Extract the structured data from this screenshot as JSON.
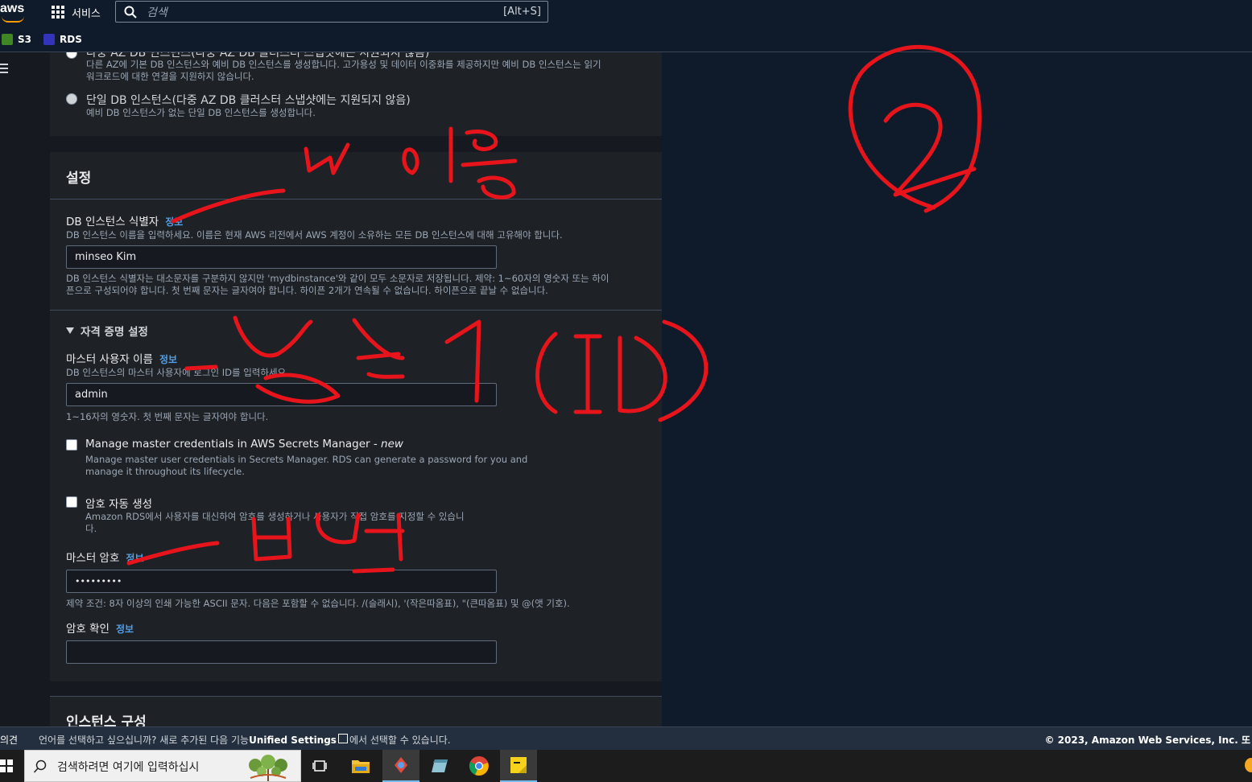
{
  "topnav": {
    "logo": "aws",
    "services_label": "서비스",
    "search_placeholder": "검색",
    "search_shortcut": "[Alt+S]"
  },
  "favorites": [
    {
      "label": "S3",
      "icon": "s3-icon",
      "color": "#3f8624"
    },
    {
      "label": "RDS",
      "icon": "rds-icon",
      "color": "#3334b9"
    }
  ],
  "availability": {
    "multi_az_title": "다중 AZ DB 인스턴스(다중 AZ DB 클러스터 스냅샷에는 지원되지 않음)",
    "multi_az_desc_1": "다른 AZ에 기본 DB 인스턴스와 예비 DB 인스턴스를 생성합니다. 고가용성 및 데이터 이중화를 제공하지만 예비 DB 인스턴스는 읽기",
    "multi_az_desc_2": "워크로드에 대한 연결을 지원하지 않습니다.",
    "single_title": "단일 DB 인스턴스(다중 AZ DB 클러스터 스냅샷에는 지원되지 않음)",
    "single_desc": "예비 DB 인스턴스가 없는 단일 DB 인스턴스를 생성합니다."
  },
  "settings": {
    "title": "설정",
    "db_identifier": {
      "label": "DB 인스턴스 식별자",
      "info": "정보",
      "desc": "DB 인스턴스 이름을 입력하세요. 이름은 현재 AWS 리전에서 AWS 계정이 소유하는 모든 DB 인스턴스에 대해 고유해야 합니다.",
      "value": "minseo Kim",
      "constraint_1": "DB 인스턴스 식별자는 대소문자를 구분하지 않지만 'mydbinstance'와 같이 모두 소문자로 저장됩니다. 제약: 1~60자의 영숫자 또는 하이",
      "constraint_2": "픈으로 구성되어야 합니다. 첫 번째 문자는 글자여야 합니다. 하이픈 2개가 연속될 수 없습니다. 하이픈으로 끝날 수 없습니다."
    },
    "credentials": {
      "title": "자격 증명 설정",
      "master_user_label": "마스터 사용자 이름",
      "master_user_info": "정보",
      "master_user_desc": "DB 인스턴스의 마스터 사용자에 로그인 ID를 입력하세요.",
      "master_user_value": "admin",
      "master_user_constraint": "1~16자의 영숫자. 첫 번째 문자는 글자여야 합니다.",
      "secrets_title": "Manage master credentials in AWS Secrets Manager - ",
      "secrets_new": "new",
      "secrets_desc_1": "Manage master user credentials in Secrets Manager. RDS can generate a password for you and",
      "secrets_desc_2": "manage it throughout its lifecycle.",
      "autogen_title": "암호 자동 생성",
      "autogen_desc_1": "Amazon RDS에서 사용자를 대신하여 암호를 생성하거나 사용자가 직접 암호를 지정할 수 있습니",
      "autogen_desc_2": "다.",
      "master_pw_label": "마스터 암호",
      "master_pw_info": "정보",
      "master_pw_value": "•••••••••",
      "master_pw_constraint": "제약 조건: 8자 이상의 인쇄 가능한 ASCII 문자. 다음은 포함할 수 없습니다. /(슬래시), '(작은따옴표), \"(큰따옴표) 및 @(앳 기호).",
      "confirm_pw_label": "암호 확인",
      "confirm_pw_info": "정보",
      "confirm_pw_value": ""
    }
  },
  "instance_config": {
    "title": "인스턴스 구성"
  },
  "footer": {
    "feedback": "의견",
    "message_prefix": "언어를 선택하고 싶으십니까? 새로 추가된 다음 기능",
    "message_link": "Unified Settings",
    "message_suffix": "에서 선택할 수 있습니다.",
    "copyright": "© 2023, Amazon Web Services, Inc. 또"
  },
  "taskbar": {
    "search_placeholder": "검색하려면 여기에 입력하십시",
    "apps": [
      "task-view-icon",
      "file-explorer-icon",
      "app-icon",
      "notepad-icon",
      "chrome-icon",
      "sticky-notes-icon"
    ]
  },
  "annotations": {
    "circle_number": "2",
    "colors": {
      "ink": "#e8141b"
    }
  }
}
